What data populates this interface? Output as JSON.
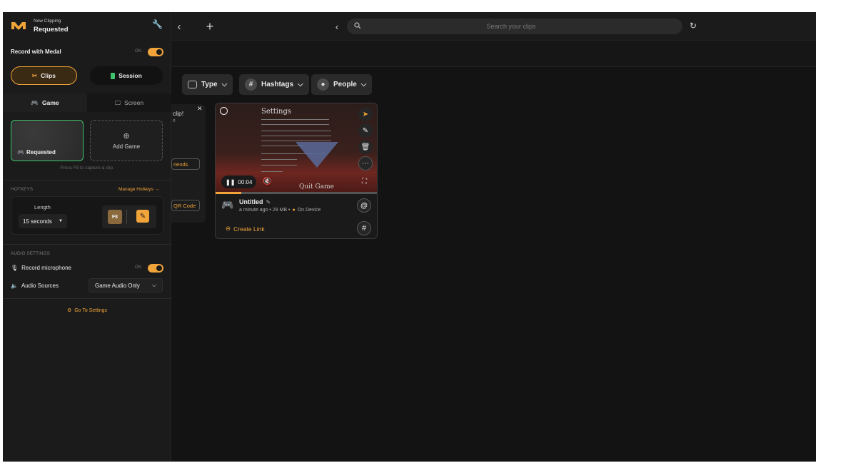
{
  "app": {
    "status_label": "Now Clipping",
    "status_value": "Requested"
  },
  "topbar": {
    "search_placeholder": "Search your clips"
  },
  "panel": {
    "record_with_medal": "Record with Medal",
    "record_toggle": "ON",
    "clips_label": "Clips",
    "session_label": "Session",
    "tab_game": "Game",
    "tab_screen": "Screen",
    "game_card_label": "Requested",
    "add_game_label": "Add Game",
    "capture_hint": "Press F8 to capture a clip.",
    "hotkeys_heading": "HOTKEYS",
    "manage_hotkeys": "Manage Hotkeys →",
    "length_label": "Length",
    "length_value": "15 seconds",
    "hotkey_key": "F8",
    "audio_heading": "AUDIO SETTINGS",
    "record_mic_label": "Record microphone",
    "mic_toggle": "ON",
    "audio_sources_label": "Audio Sources",
    "audio_sources_value": "Game Audio Only",
    "go_to_settings": "Go To Settings"
  },
  "filters": {
    "type": "Type",
    "hashtags": "Hashtags",
    "people": "People"
  },
  "popover": {
    "text1": "clip!",
    "text2": "e",
    "btn_friends": "riends",
    "btn_qr": "QR Code"
  },
  "clip": {
    "time": "00:04",
    "title": "Untitled",
    "meta": "a minute ago • 29 MB •",
    "location": "On Device",
    "create_link": "Create Link",
    "thumb_title": "Settings",
    "thumb_footer": "Quit Game",
    "progress": 0.16
  },
  "colors": {
    "accent": "#f0a43a",
    "panel_bg": "#1b1b1b",
    "app_bg": "#131313",
    "session_green": "#3ec46d"
  },
  "icons": [
    "medal-logo-icon",
    "wrench-icon",
    "back-icon",
    "plus-icon",
    "search-icon",
    "refresh-icon",
    "scissors-icon",
    "gamepad-icon",
    "monitor-icon",
    "plus-circle-icon",
    "microphone-icon",
    "speaker-icon",
    "gear-icon",
    "image-icon",
    "hashtag-icon",
    "person-icon",
    "chevron-down-icon",
    "share-icon",
    "edit-icon",
    "trash-icon",
    "more-icon",
    "pause-icon",
    "mute-icon",
    "fullscreen-icon",
    "at-icon",
    "link-icon",
    "pencil-icon",
    "close-icon"
  ]
}
